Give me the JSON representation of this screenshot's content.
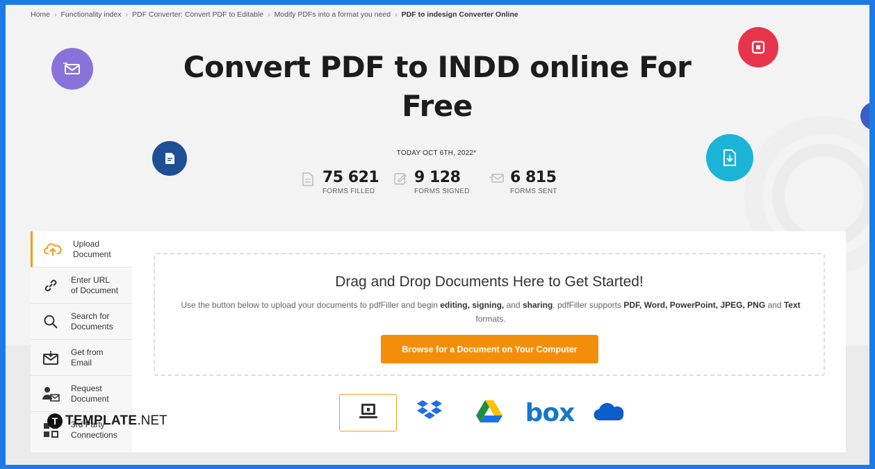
{
  "breadcrumb": {
    "items": [
      "Home",
      "Functionality index",
      "PDF Converter: Convert PDF to Editable",
      "Modify PDFs into a format you need"
    ],
    "current": "PDF to indesign Converter Online",
    "separator": "›"
  },
  "hero": {
    "title": "Convert PDF to INDD online For Free",
    "date": "TODAY OCT 6TH, 2022*"
  },
  "stats": [
    {
      "value": "75 621",
      "label": "FORMS FILLED",
      "icon": "form-filled-icon"
    },
    {
      "value": "9 128",
      "label": "FORMS SIGNED",
      "icon": "form-signed-icon"
    },
    {
      "value": "6 815",
      "label": "FORMS SENT",
      "icon": "form-sent-icon"
    }
  ],
  "sidebar": {
    "items": [
      {
        "label1": "Upload",
        "label2": "Document",
        "icon": "upload-cloud-icon",
        "active": true
      },
      {
        "label1": "Enter URL",
        "label2": "of Document",
        "icon": "link-icon"
      },
      {
        "label1": "Search for",
        "label2": "Documents",
        "icon": "search-icon"
      },
      {
        "label1": "Get from",
        "label2": "Email",
        "icon": "email-icon"
      },
      {
        "label1": "Request",
        "label2": "Document",
        "icon": "request-user-icon"
      },
      {
        "label1": "3rd Party",
        "label2": "Connections",
        "icon": "connections-icon"
      }
    ]
  },
  "dropzone": {
    "title": "Drag and Drop Documents Here to Get Started!",
    "desc_part1": "Use the button below to upload your documents to pdfFiller and begin ",
    "desc_b1": "editing,",
    "desc_b2": "signing,",
    "desc_part2": " and ",
    "desc_b3": "sharing",
    "desc_part3": ". pdfFiller supports ",
    "desc_b4": "PDF, Word, PowerPoint, JPEG, PNG",
    "desc_part4": " and ",
    "desc_b5": "Text",
    "desc_part5": " formats.",
    "button": "Browse for a Document on Your Computer"
  },
  "sources": [
    {
      "name": "computer",
      "icon": "computer-icon",
      "active": true
    },
    {
      "name": "dropbox",
      "icon": "dropbox-icon"
    },
    {
      "name": "google-drive",
      "icon": "google-drive-icon"
    },
    {
      "name": "box",
      "label": "box"
    },
    {
      "name": "onedrive",
      "icon": "onedrive-icon"
    }
  ],
  "watermark": {
    "logo_letter": "T",
    "brand": "TEMPLATE",
    "suffix": ".NET"
  },
  "colors": {
    "frame": "#1e7be5",
    "accent": "#f38e0a",
    "bubble_purple": "#8a73d8",
    "bubble_red": "#e8344b",
    "bubble_navy": "#1e4f94",
    "bubble_cyan": "#1cb4d6"
  }
}
